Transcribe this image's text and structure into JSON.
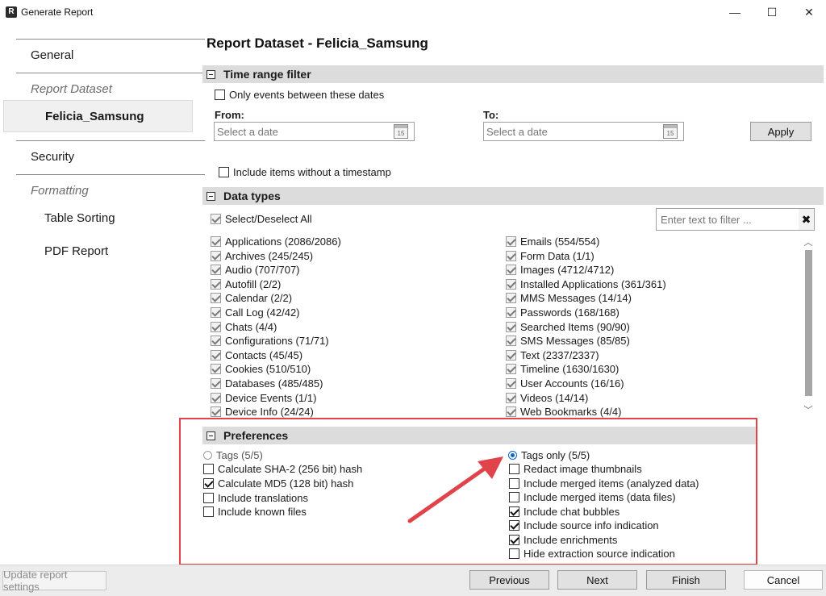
{
  "window": {
    "app_icon_letter": "R",
    "title": "Generate Report",
    "minimize_glyph": "—",
    "maximize_glyph": "☐",
    "close_glyph": "✕"
  },
  "sidebar": {
    "items": [
      {
        "label": "General"
      },
      {
        "label": "Report Dataset"
      },
      {
        "label": "Felicia_Samsung"
      },
      {
        "label": "Security"
      },
      {
        "label": "Formatting"
      },
      {
        "label": "Table Sorting"
      },
      {
        "label": "PDF Report"
      }
    ]
  },
  "page": {
    "title": "Report Dataset - Felicia_Samsung"
  },
  "time_range": {
    "header": "Time range filter",
    "only_between_label": "Only events between these dates",
    "only_between_checked": false,
    "from_label": "From:",
    "to_label": "To:",
    "date_placeholder": "Select a date",
    "calendar_day": "15",
    "apply_label": "Apply",
    "include_no_timestamp_label": "Include items without a timestamp",
    "include_no_timestamp_checked": false
  },
  "data_types": {
    "header": "Data types",
    "select_all_label": "Select/Deselect All",
    "filter_placeholder": "Enter text to filter ...",
    "filter_clear": "✖",
    "scroll_up": "︿",
    "scroll_down": "﹀",
    "left_column": [
      "Applications (2086/2086)",
      "Archives (245/245)",
      "Audio (707/707)",
      "Autofill (2/2)",
      "Calendar (2/2)",
      "Call Log (42/42)",
      "Chats (4/4)",
      "Configurations (71/71)",
      "Contacts (45/45)",
      "Cookies (510/510)",
      "Databases (485/485)",
      "Device Events (1/1)",
      "Device Info (24/24)"
    ],
    "right_column": [
      "Emails (554/554)",
      "Form Data (1/1)",
      "Images (4712/4712)",
      "Installed Applications (361/361)",
      "MMS Messages (14/14)",
      "Passwords (168/168)",
      "Searched Items (90/90)",
      "SMS Messages (85/85)",
      "Text (2337/2337)",
      "Timeline (1630/1630)",
      "User Accounts (16/16)",
      "Videos (14/14)",
      "Web Bookmarks (4/4)"
    ]
  },
  "preferences": {
    "header": "Preferences",
    "radio_tags_label": "Tags (5/5)",
    "radio_tags_only_label": "Tags only (5/5)",
    "selected_radio": "tags_only",
    "left": [
      {
        "label": "Calculate SHA-2 (256 bit) hash",
        "checked": false
      },
      {
        "label": "Calculate MD5 (128 bit) hash",
        "checked": true
      },
      {
        "label": "Include translations",
        "checked": false
      },
      {
        "label": "Include known files",
        "checked": false
      }
    ],
    "right": [
      {
        "label": "Redact image thumbnails",
        "checked": false
      },
      {
        "label": "Include merged items (analyzed data)",
        "checked": false
      },
      {
        "label": "Include merged items (data files)",
        "checked": false
      },
      {
        "label": "Include chat bubbles",
        "checked": true
      },
      {
        "label": "Include source info indication",
        "checked": true
      },
      {
        "label": "Include enrichments",
        "checked": true
      },
      {
        "label": "Hide extraction source indication",
        "checked": false
      }
    ]
  },
  "footer": {
    "update_label": "Update report settings",
    "previous_label": "Previous",
    "next_label": "Next",
    "finish_label": "Finish",
    "cancel_label": "Cancel"
  },
  "colors": {
    "highlight": "#e0444a",
    "radio_accent": "#0a64d0",
    "group_header": "#dcdcdc"
  }
}
